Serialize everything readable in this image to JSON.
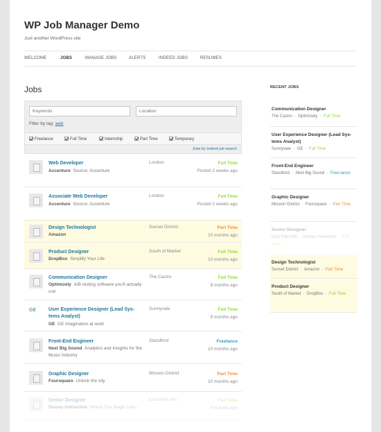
{
  "site": {
    "title": "WP Job Manager Demo",
    "description": "Just another WordPress site"
  },
  "nav": [
    "WELCOME",
    "JOBS",
    "MANAGE JOBS",
    "ALERTS",
    "INDEED JOBS",
    "RESUMES"
  ],
  "page_title": "Jobs",
  "filters": {
    "keywords_placeholder": "Keywords",
    "location_placeholder": "Location",
    "tag_label": "Filter by tag:",
    "tag": "web",
    "job_types": [
      "Freelance",
      "Full Time",
      "Internship",
      "Part Time",
      "Temporary"
    ],
    "indeed_link": "Jobs by Indeed job search"
  },
  "jobs": [
    {
      "title": "Web Developer",
      "company": "Accenture",
      "tagline": "Source: Accenture",
      "location": "London",
      "type": "Full Time",
      "date": "Posted 2 weeks ago"
    },
    {
      "title": "Associate Web Developer",
      "company": "Accenture",
      "tagline": "Source: Accenture",
      "location": "London",
      "type": "Full Time",
      "date": "Posted 2 weeks ago"
    },
    {
      "title": "Design Technologist",
      "company": "Amazon",
      "tagline": "",
      "location": "Sunset District",
      "type": "Part Time",
      "date": "10 months ago"
    },
    {
      "title": "Product Designer",
      "company": "DropBox",
      "tagline": "Simplify Your Life",
      "location": "South of Market",
      "type": "Full Time",
      "date": "10 months ago"
    },
    {
      "title": "Communication Designer",
      "company": "Optimizely",
      "tagline": "A/B testing software you'll actually use",
      "location": "The Castro",
      "type": "Full Time",
      "date": "9 months ago"
    },
    {
      "logo_text": "GE",
      "title": "User Experience Designer (Lead Sys-tems Analyst)",
      "company": "GE",
      "tagline": "GE imagination at work",
      "location": "Sunnyvale",
      "type": "Full Time",
      "date": "9 months ago"
    },
    {
      "title": "Front-End Engineer",
      "company": "Next Big Sound",
      "tagline": "Analytics and Insights for the Music Industry",
      "location": "Standford",
      "type": "Freelance",
      "date": "10 months ago"
    },
    {
      "title": "Graphic Designer",
      "company": "Foursquare",
      "tagline": "Unlock the city",
      "location": "Mission District",
      "type": "Part Time",
      "date": "10 months ago"
    },
    {
      "title": "Senior Designer",
      "company": "Disney Interactive",
      "tagline": "Where The Magic Lives",
      "location": "East Palo Alto",
      "type": "Full Time",
      "date": "9 months ago"
    }
  ],
  "sidebar": {
    "heading": "RECENT JOBS",
    "items": [
      {
        "title": "Communication Designer",
        "location": "The Castro",
        "company": "Optimizely",
        "type": "Full Time"
      },
      {
        "title": "User Experience Designer (Lead Sys-tems Analyst)",
        "location": "Sunnyvale",
        "company": "GE",
        "type": "Full Time"
      },
      {
        "title": "Front-End Engineer",
        "location": "Standford",
        "company": "Next Big Sound",
        "type": "Free-lance"
      },
      {
        "title": "Graphic Designer",
        "location": "Mission District",
        "company": "Foursquare",
        "type": "Part Time"
      },
      {
        "title": "Senior Designer",
        "location": "East Palo Alto",
        "company": "Disney Interactive",
        "type": "Full Time"
      },
      {
        "title": "Design Technologist",
        "location": "Sunset District",
        "company": "Amazon",
        "type": "Part Time"
      },
      {
        "title": "Product Designer",
        "location": "South of Market",
        "company": "DropBox",
        "type": "Full Time"
      }
    ]
  },
  "colors": {
    "link": "#21759b",
    "full_time": "#90da36",
    "part_time": "#f08d3c",
    "freelance": "#3399cc",
    "featured_bg": "#fefbe1"
  }
}
